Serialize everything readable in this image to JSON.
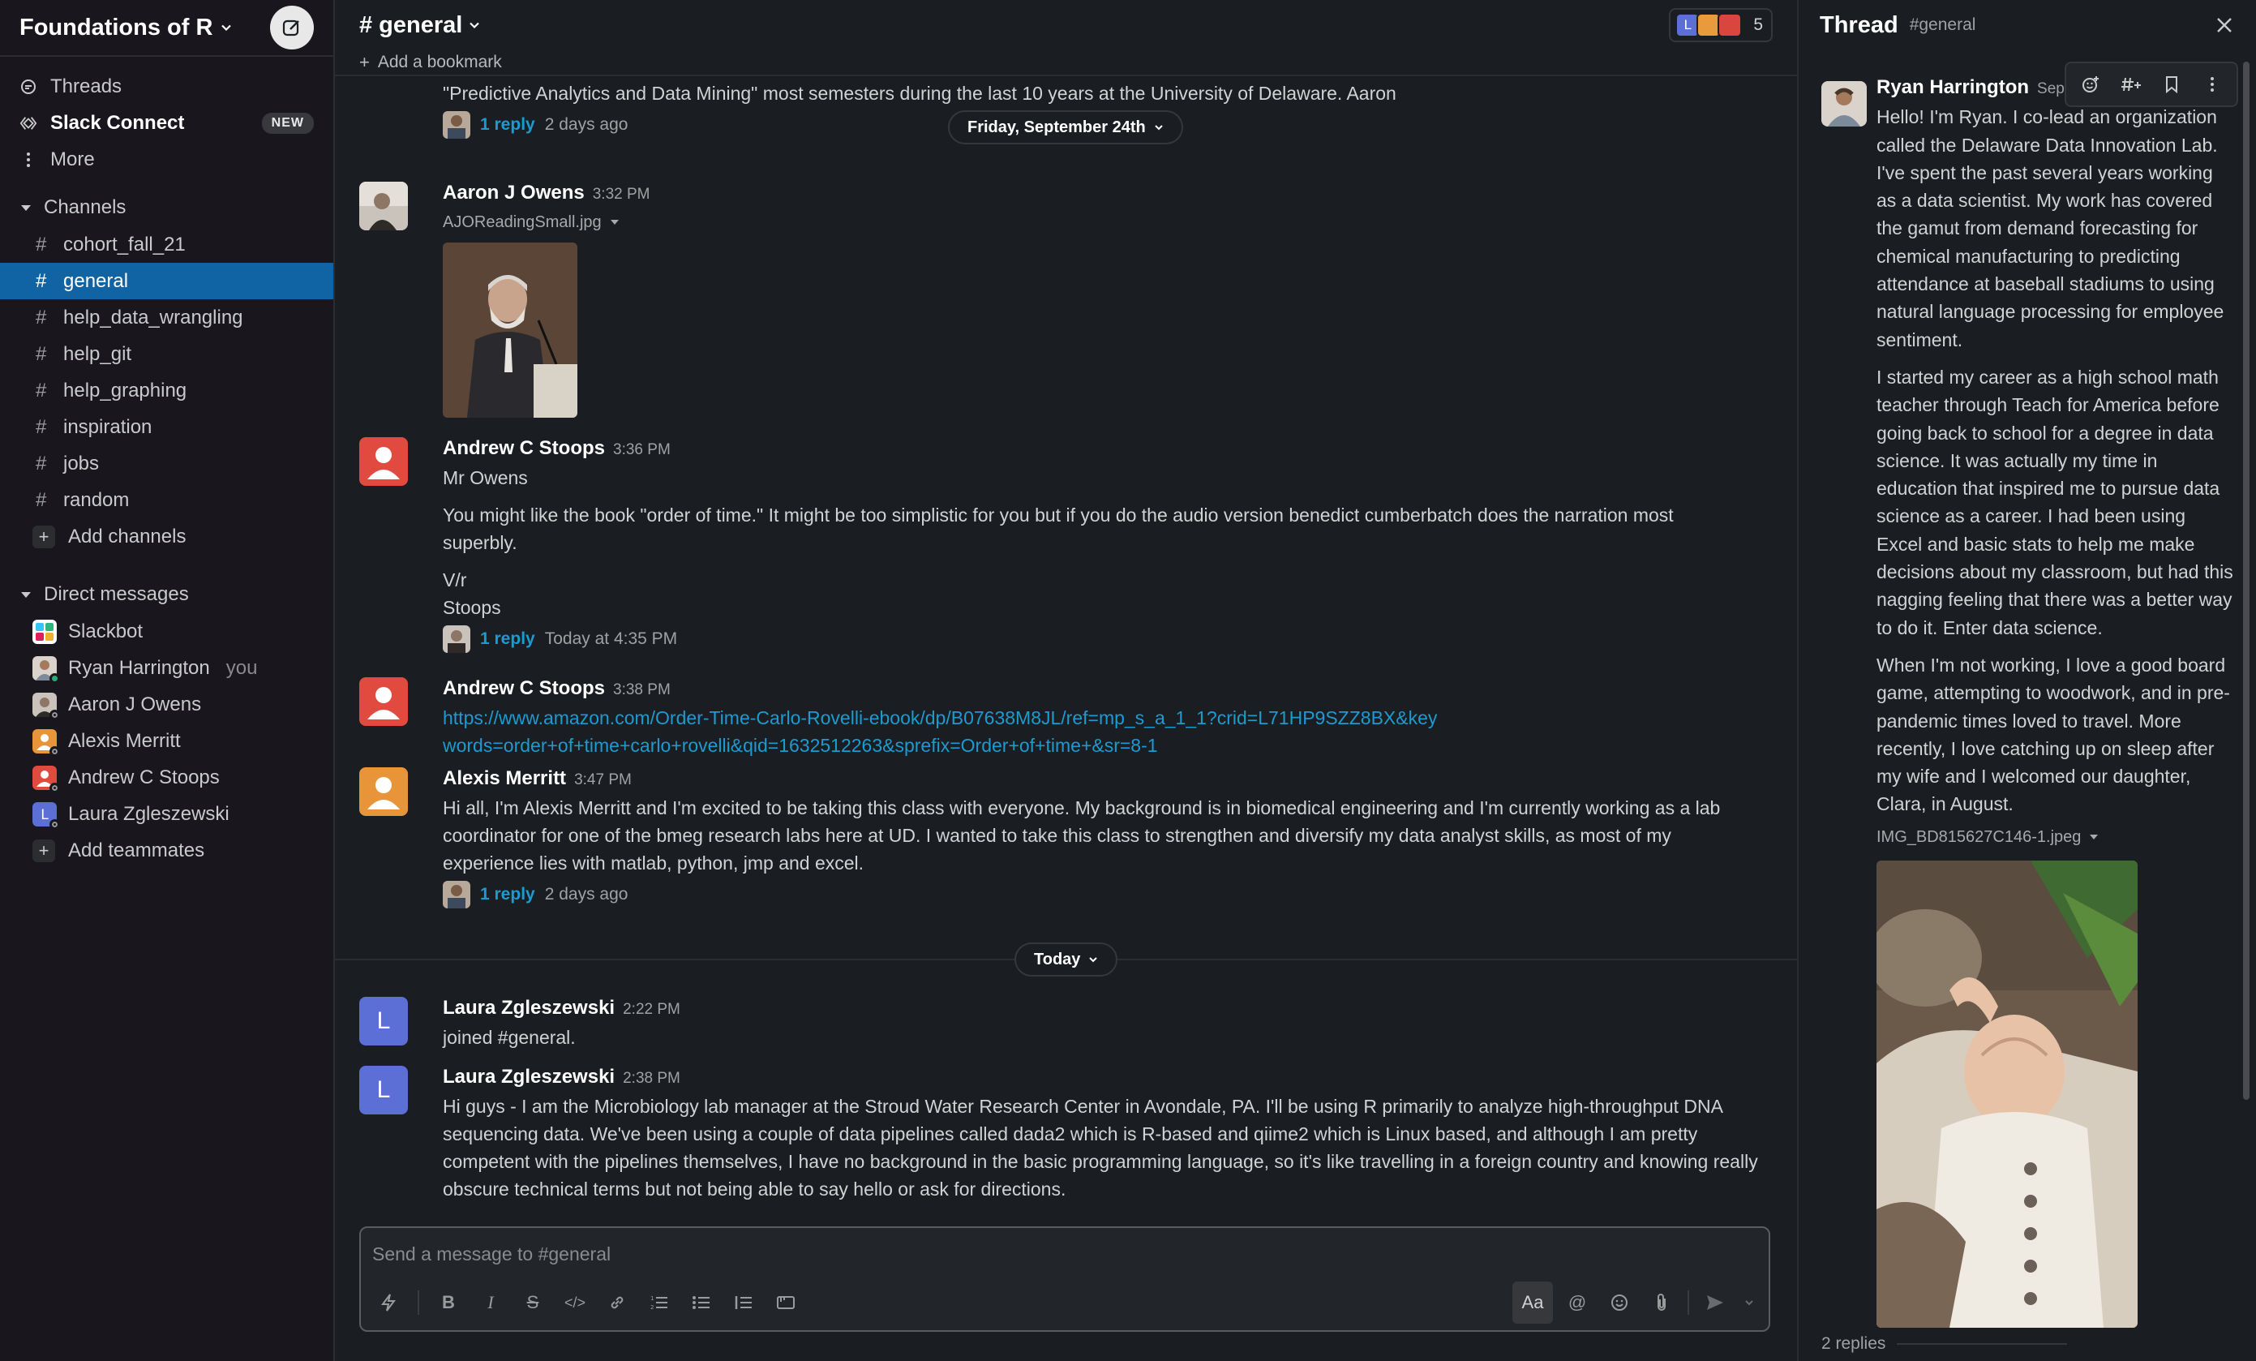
{
  "workspace": {
    "name": "Foundations of R"
  },
  "nav": {
    "threads": "Threads",
    "slack_connect": "Slack Connect",
    "slack_connect_badge": "NEW",
    "more": "More"
  },
  "channels": {
    "header": "Channels",
    "items": [
      "cohort_fall_21",
      "general",
      "help_data_wrangling",
      "help_git",
      "help_graphing",
      "inspiration",
      "jobs",
      "random"
    ],
    "active": "general",
    "add": "Add channels"
  },
  "dms": {
    "header": "Direct messages",
    "items": [
      {
        "name": "Slackbot",
        "suffix": ""
      },
      {
        "name": "Ryan Harrington",
        "suffix": "you"
      },
      {
        "name": "Aaron J Owens",
        "suffix": ""
      },
      {
        "name": "Alexis Merritt",
        "suffix": ""
      },
      {
        "name": "Andrew C Stoops",
        "suffix": ""
      },
      {
        "name": "Laura Zgleszewski",
        "suffix": ""
      }
    ],
    "add": "Add teammates"
  },
  "channel_header": {
    "title": "# general",
    "member_count": "5",
    "add_bookmark": "Add a bookmark"
  },
  "messages": {
    "m0": {
      "text": "\"Predictive Analytics and Data Mining\" most semesters during the last 10 years at the University of Delaware. Aaron",
      "reply_count": "1 reply",
      "reply_time": "2 days ago"
    },
    "date_pill_1": "Friday, September 24th",
    "m1": {
      "author": "Aaron J Owens",
      "time": "3:32 PM",
      "file": "AJOReadingSmall.jpg"
    },
    "m2": {
      "author": "Andrew C Stoops",
      "time": "3:36 PM",
      "line1": "Mr Owens",
      "line2": "You might like the book \"order of time.\"  It might be too simplistic for you but if you do the audio version benedict cumberbatch does the narration most superbly.",
      "line3": "V/r",
      "line4": "Stoops",
      "reply_count": "1 reply",
      "reply_time": "Today at 4:35 PM"
    },
    "m3": {
      "author": "Andrew C Stoops",
      "time": "3:38 PM",
      "link": "https://www.amazon.com/Order-Time-Carlo-Rovelli-ebook/dp/B07638M8JL/ref=mp_s_a_1_1?crid=L71HP9SZZ8BX&keywords=order+of+time+carlo+rovelli&qid=1632512263&sprefix=Order+of+time+&sr=8-1"
    },
    "m4": {
      "author": "Alexis Merritt",
      "time": "3:47 PM",
      "text": "Hi all, I'm Alexis Merritt and I'm excited to be taking this class with everyone. My background is in biomedical engineering and I'm currently working as a lab coordinator for one of the bmeg research labs here at UD. I wanted to take this class to strengthen and diversify my data analyst skills, as most of my experience lies with matlab, python, jmp and excel.",
      "reply_count": "1 reply",
      "reply_time": "2 days ago"
    },
    "date_pill_2": "Today",
    "m5": {
      "author": "Laura Zgleszewski",
      "time": "2:22 PM",
      "text": "joined #general."
    },
    "m6": {
      "author": "Laura Zgleszewski",
      "time": "2:38 PM",
      "text": "Hi guys - I am the Microbiology lab manager at the Stroud Water Research Center in Avondale, PA. I'll be using R primarily to analyze high-throughput DNA sequencing data. We've been using a couple of data pipelines called dada2 which is R-based and qiime2 which is Linux based, and although I am pretty competent with the pipelines themselves, I have no background in the basic programming language, so it's like travelling in a foreign country and knowing really obscure technical terms but not being able to say hello or ask for directions."
    }
  },
  "composer": {
    "placeholder": "Send a message to #general",
    "aa": "Aa"
  },
  "thread": {
    "title": "Thread",
    "channel": "#general",
    "author": "Ryan Harrington",
    "time": "Sep 2",
    "p1": "Hello! I'm Ryan. I co-lead an organization called the Delaware Data Innovation Lab. I've spent the past several years working as a data scientist. My work has covered the gamut from demand forecasting for chemical manufacturing to predicting attendance at baseball stadiums to using natural language processing for employee sentiment.",
    "p2": "I started my career as a high school math teacher through Teach for America before going back to school for a degree in data science. It was actually my time in education that inspired me to pursue data science as a career. I had been using Excel and basic stats to help me make decisions about my classroom, but had this nagging feeling that there was a better way to do it. Enter data science.",
    "p3": "When I'm not working, I love a good board game, attempting to woodwork, and in pre-pandemic times loved to travel. More recently, I love catching up on sleep after my wife and I welcomed our daughter, Clara, in August.",
    "file": "IMG_BD815627C146-1.jpeg",
    "replies": "2 replies"
  },
  "colors": {
    "accent": "#1164a3",
    "link": "#1d9bd1",
    "presence": "#2bac76",
    "laura": "#5b6fd6"
  }
}
